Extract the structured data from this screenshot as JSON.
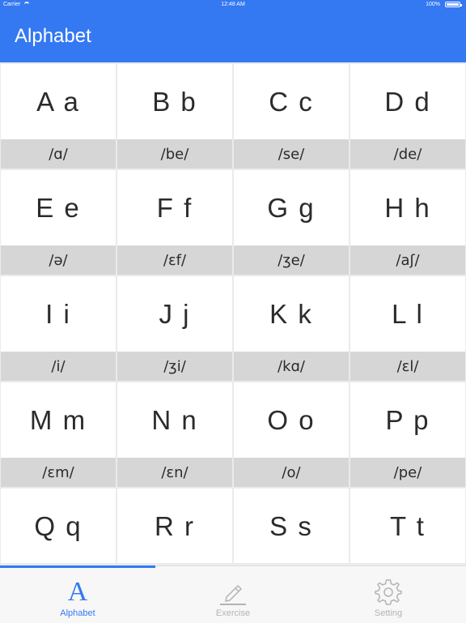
{
  "status_bar": {
    "carrier": "Carrier",
    "time": "12:48 AM",
    "battery": "100%"
  },
  "header": {
    "title": "Alphabet"
  },
  "letters": [
    {
      "letter": "A a",
      "ipa": "/ɑ/"
    },
    {
      "letter": "B b",
      "ipa": "/be/"
    },
    {
      "letter": "C c",
      "ipa": "/se/"
    },
    {
      "letter": "D d",
      "ipa": "/de/"
    },
    {
      "letter": "E e",
      "ipa": "/ə/"
    },
    {
      "letter": "F f",
      "ipa": "/ɛf/"
    },
    {
      "letter": "G g",
      "ipa": "/ʒe/"
    },
    {
      "letter": "H h",
      "ipa": "/aʃ/"
    },
    {
      "letter": "I i",
      "ipa": "/i/"
    },
    {
      "letter": "J j",
      "ipa": "/ʒi/"
    },
    {
      "letter": "K k",
      "ipa": "/kɑ/"
    },
    {
      "letter": "L l",
      "ipa": "/ɛl/"
    },
    {
      "letter": "M m",
      "ipa": "/ɛm/"
    },
    {
      "letter": "N n",
      "ipa": "/ɛn/"
    },
    {
      "letter": "O o",
      "ipa": "/o/"
    },
    {
      "letter": "P p",
      "ipa": "/pe/"
    },
    {
      "letter": "Q q",
      "ipa": ""
    },
    {
      "letter": "R r",
      "ipa": ""
    },
    {
      "letter": "S s",
      "ipa": ""
    },
    {
      "letter": "T t",
      "ipa": ""
    }
  ],
  "tabs": [
    {
      "label": "Alphabet",
      "icon": "alphabet-icon",
      "active": true
    },
    {
      "label": "Exercise",
      "icon": "pencil-icon",
      "active": false
    },
    {
      "label": "Setting",
      "icon": "gear-icon",
      "active": false
    }
  ],
  "colors": {
    "accent": "#3478f2",
    "ipa_bg": "#d6d6d6",
    "inactive": "#b3b3b3"
  }
}
